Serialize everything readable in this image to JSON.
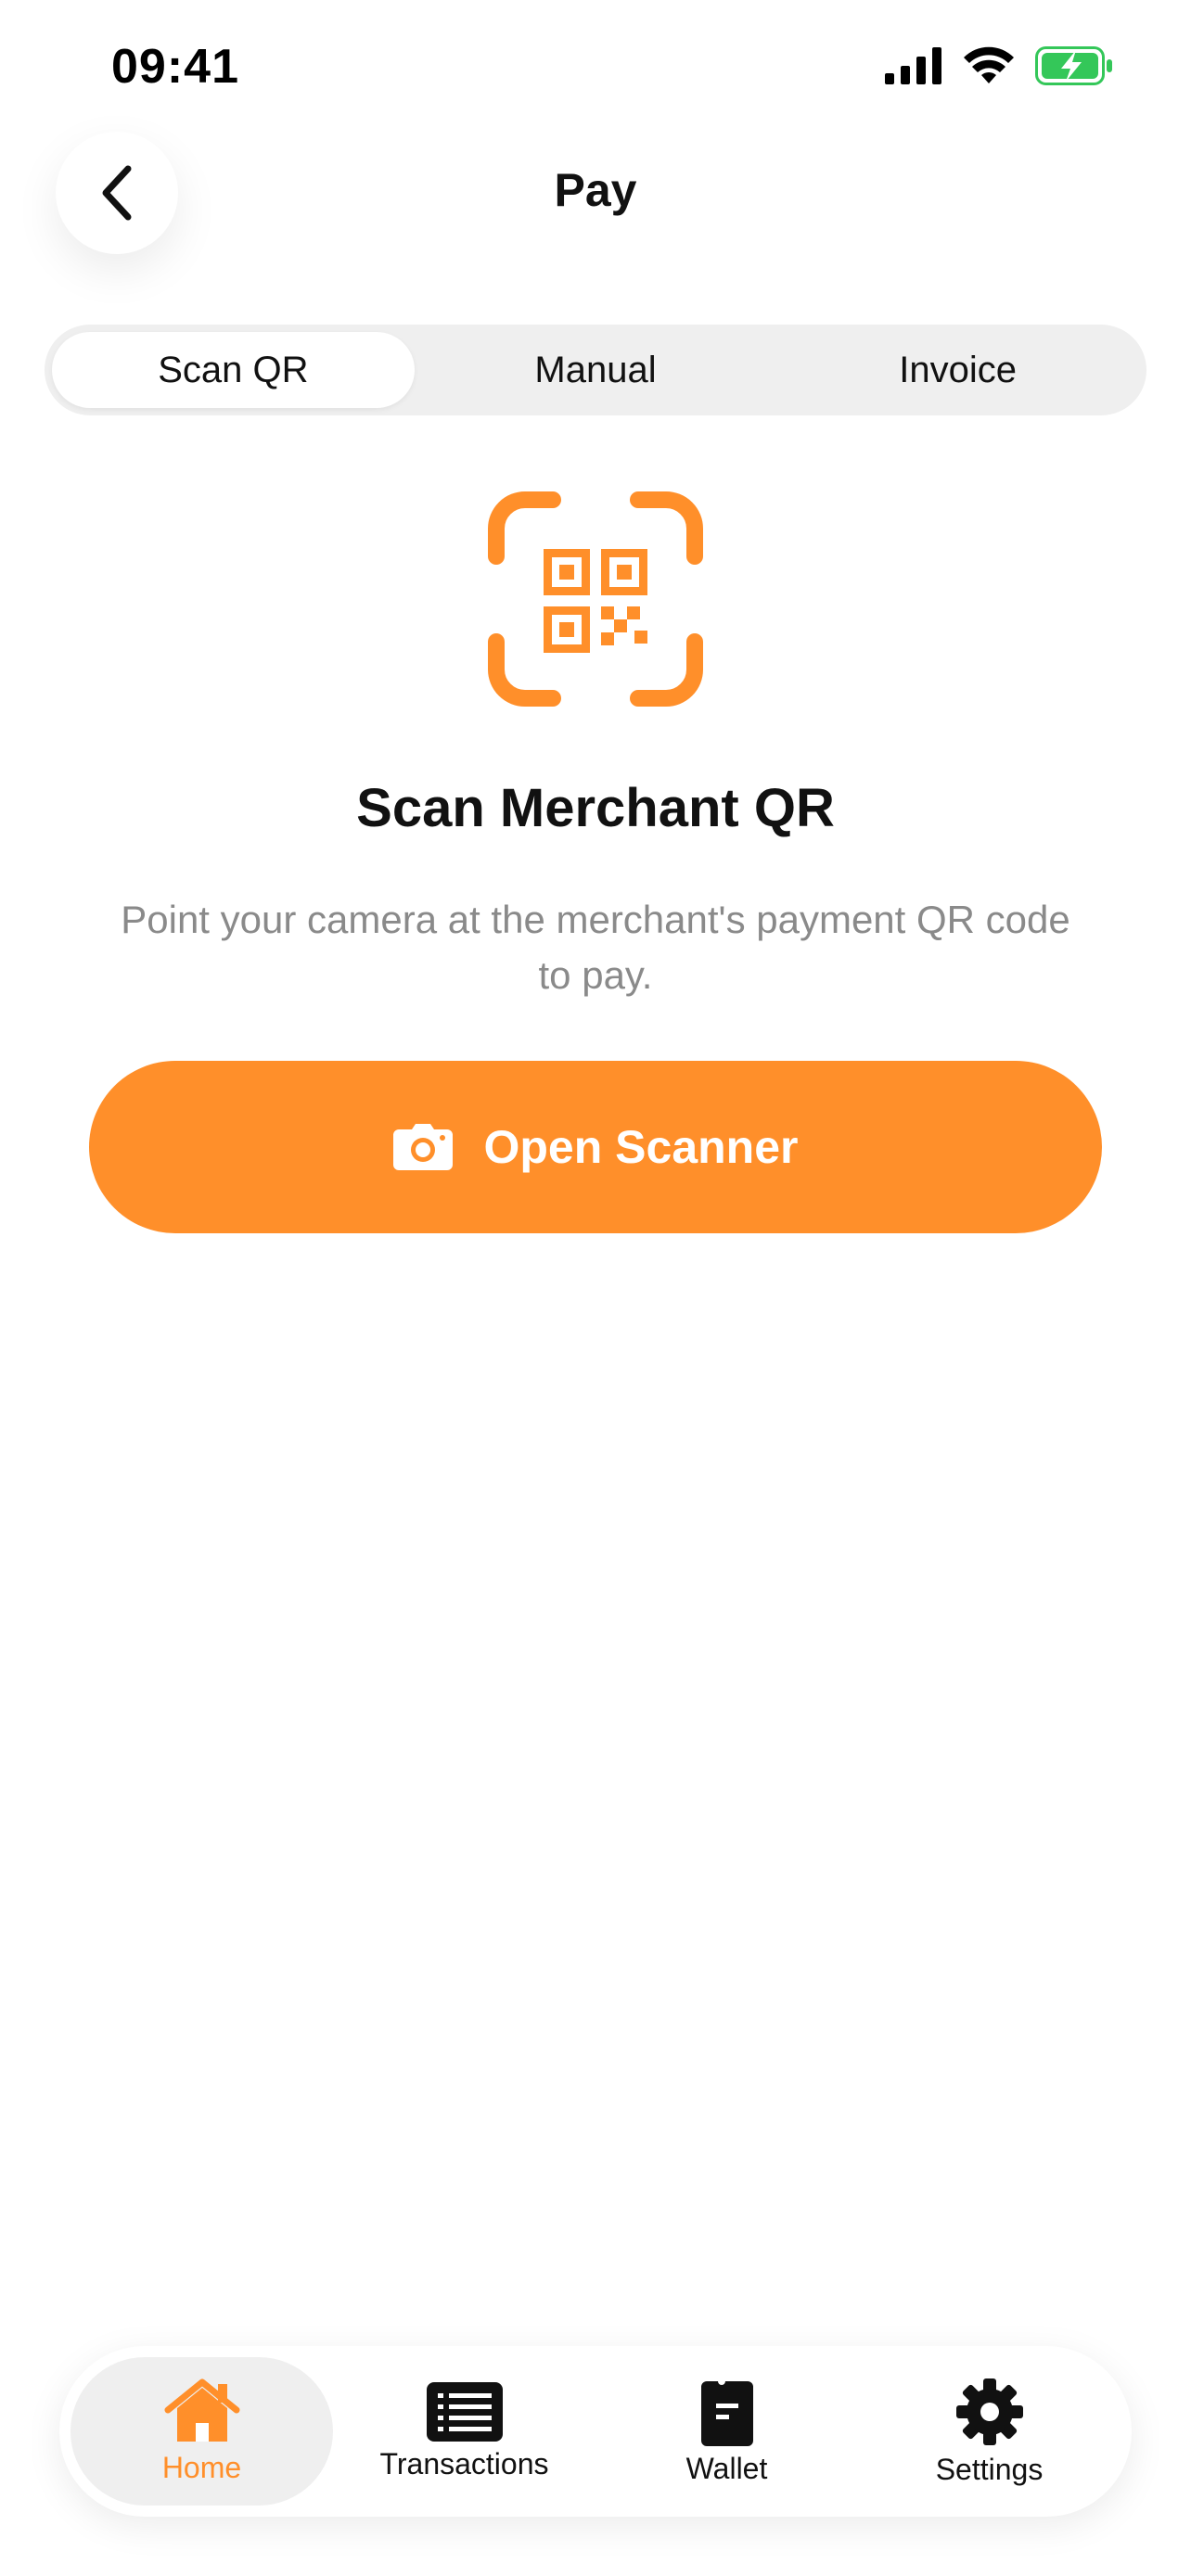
{
  "status_bar": {
    "time": "09:41"
  },
  "header": {
    "title": "Pay",
    "back_icon": "chevron-left-icon"
  },
  "segmented": {
    "tabs": [
      {
        "label": "Scan QR",
        "active": true
      },
      {
        "label": "Manual",
        "active": false
      },
      {
        "label": "Invoice",
        "active": false
      }
    ]
  },
  "scan": {
    "icon": "qr-code-icon",
    "title": "Scan Merchant QR",
    "description": "Point your camera at the merchant's payment QR code to pay.",
    "button_label": "Open Scanner",
    "button_icon": "camera-icon"
  },
  "tab_bar": {
    "items": [
      {
        "label": "Home",
        "icon": "home-icon",
        "active": true
      },
      {
        "label": "Transactions",
        "icon": "list-icon",
        "active": false
      },
      {
        "label": "Wallet",
        "icon": "wallet-icon",
        "active": false
      },
      {
        "label": "Settings",
        "icon": "gear-icon",
        "active": false
      }
    ]
  },
  "colors": {
    "accent": "#ff8f2a",
    "battery": "#34c759",
    "segment_bg": "#efefef",
    "muted_text": "#8a8a8a"
  }
}
